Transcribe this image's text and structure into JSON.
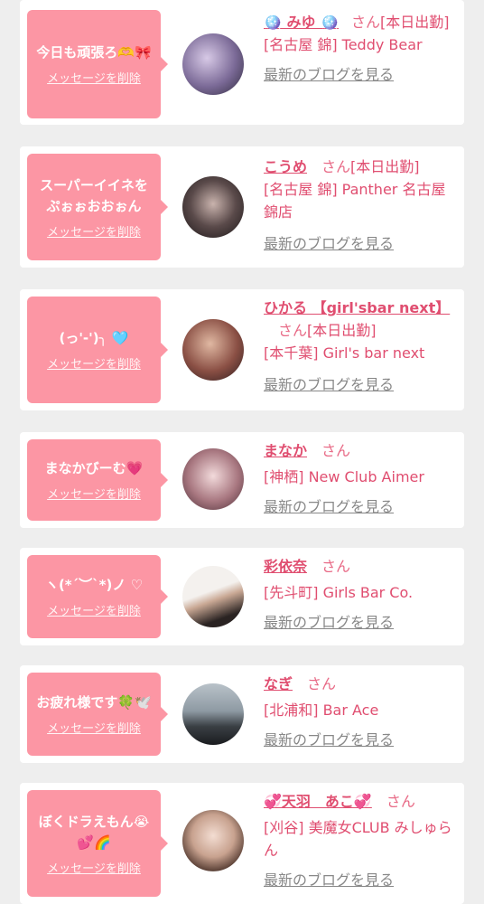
{
  "colors": {
    "bubble": "#fc96a4",
    "accent": "#e04e70",
    "background": "#eeeeee"
  },
  "san_label": "さん",
  "delete_label": "メッセージを削除",
  "blog_label": "最新のブログを見る",
  "items": [
    {
      "message": "今日も頑張ろ🫶🎀",
      "name": "🪩 みゆ 🪩",
      "status": "[本日出勤]",
      "shop": "[名古屋 錦] Teddy Bear"
    },
    {
      "message": "スーパーイイネをぷぉぉおおぉん",
      "name": "こうめ",
      "status": "[本日出勤]",
      "shop": "[名古屋 錦] Panther 名古屋錦店"
    },
    {
      "message": "(っ'-')╮ 🩵",
      "name": "ひかる 【girl'sbar next】",
      "status": "[本日出勤]",
      "shop": "[本千葉] Girl's bar next"
    },
    {
      "message": "まなかびーむ💗",
      "name": "まなか",
      "status": "",
      "shop": "[神栖] New Club Aimer"
    },
    {
      "message": "ヽ(*´︶`*)ノ ♡",
      "name": "彩依奈",
      "status": "",
      "shop": "[先斗町] Girls Bar Co."
    },
    {
      "message": "お疲れ様です🍀🕊️",
      "name": "なぎ",
      "status": "",
      "shop": "[北浦和] Bar Ace"
    },
    {
      "message": "ぼくドラえもん😭💕🌈",
      "name": "💞天羽　あこ💞",
      "status": "",
      "shop": "[刈谷] 美魔女CLUB みしゅらん"
    }
  ]
}
